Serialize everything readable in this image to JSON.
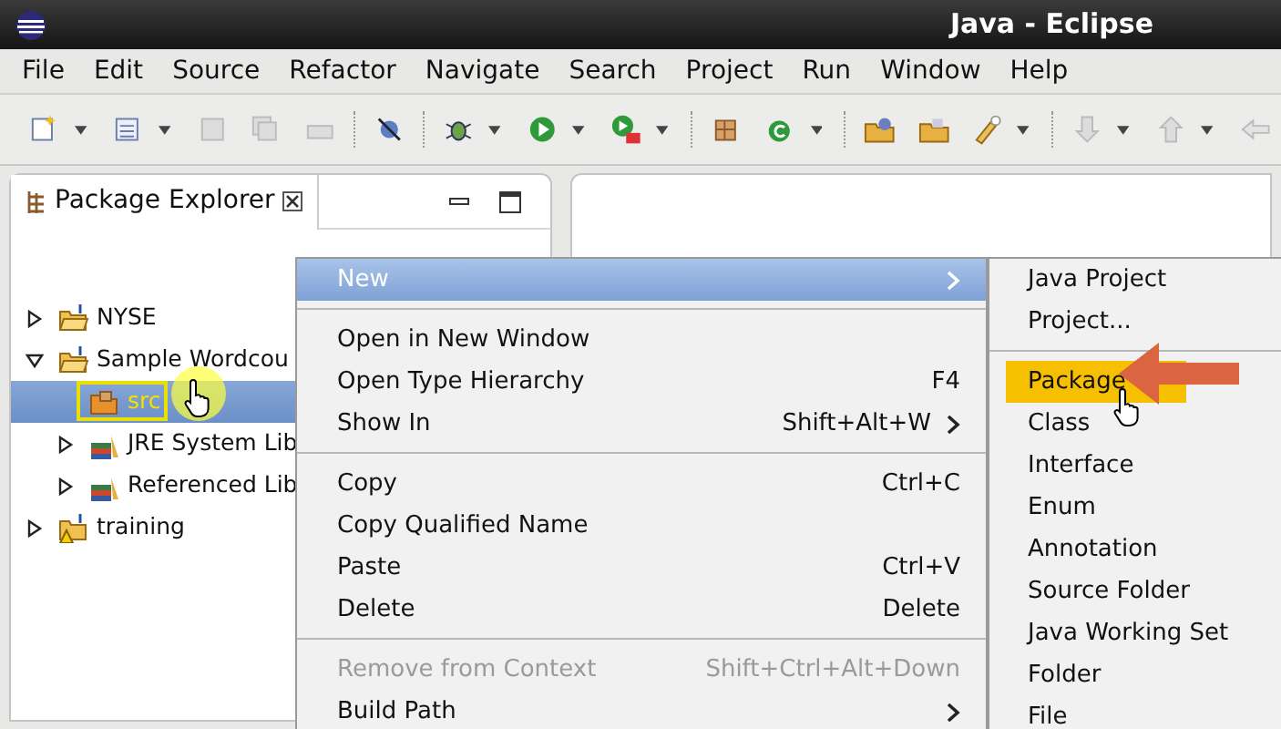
{
  "window": {
    "title": "Java - Eclipse"
  },
  "menu_bar": [
    "File",
    "Edit",
    "Source",
    "Refactor",
    "Navigate",
    "Search",
    "Project",
    "Run",
    "Window",
    "Help"
  ],
  "package_explorer": {
    "tab_title": "Package Explorer",
    "tree": [
      {
        "label": "NYSE",
        "kind": "project",
        "expanded": false,
        "selected": false
      },
      {
        "label": "Sample Wordcou",
        "kind": "project",
        "expanded": true,
        "selected": false,
        "children": [
          {
            "label": "src",
            "kind": "source",
            "selected": true
          },
          {
            "label": "JRE System Lib",
            "kind": "library",
            "expanded": false,
            "selected": false
          },
          {
            "label": "Referenced Lib",
            "kind": "library",
            "expanded": false,
            "selected": false
          }
        ]
      },
      {
        "label": "training",
        "kind": "warning-project",
        "expanded": false,
        "selected": false
      }
    ]
  },
  "context_menu": [
    {
      "kind": "item",
      "label": "New",
      "submenu": true,
      "selected": true,
      "disabled": false
    },
    {
      "kind": "separator"
    },
    {
      "kind": "item",
      "label": "Open in New Window",
      "submenu": false,
      "selected": false,
      "disabled": false
    },
    {
      "kind": "item",
      "label": "Open Type Hierarchy",
      "shortcut": "F4",
      "submenu": false,
      "selected": false,
      "disabled": false
    },
    {
      "kind": "item",
      "label": "Show In",
      "shortcut": "Shift+Alt+W",
      "submenu": true,
      "selected": false,
      "disabled": false
    },
    {
      "kind": "separator"
    },
    {
      "kind": "item",
      "label": "Copy",
      "shortcut": "Ctrl+C",
      "submenu": false,
      "selected": false,
      "disabled": false
    },
    {
      "kind": "item",
      "label": "Copy Qualified Name",
      "submenu": false,
      "selected": false,
      "disabled": false
    },
    {
      "kind": "item",
      "label": "Paste",
      "shortcut": "Ctrl+V",
      "submenu": false,
      "selected": false,
      "disabled": false
    },
    {
      "kind": "item",
      "label": "Delete",
      "shortcut": "Delete",
      "submenu": false,
      "selected": false,
      "disabled": false
    },
    {
      "kind": "separator"
    },
    {
      "kind": "item",
      "label": "Remove from Context",
      "shortcut": "Shift+Ctrl+Alt+Down",
      "submenu": false,
      "selected": false,
      "disabled": true
    },
    {
      "kind": "item",
      "label": "Build Path",
      "submenu": true,
      "selected": false,
      "disabled": false
    }
  ],
  "new_submenu": [
    {
      "kind": "item",
      "label": "Java Project",
      "selected": false
    },
    {
      "kind": "item",
      "label": "Project...",
      "selected": false
    },
    {
      "kind": "separator"
    },
    {
      "kind": "item",
      "label": "Package",
      "selected": true
    },
    {
      "kind": "item",
      "label": "Class",
      "selected": false
    },
    {
      "kind": "item",
      "label": "Interface",
      "selected": false
    },
    {
      "kind": "item",
      "label": "Enum",
      "selected": false
    },
    {
      "kind": "item",
      "label": "Annotation",
      "selected": false
    },
    {
      "kind": "item",
      "label": "Source Folder",
      "selected": false
    },
    {
      "kind": "item",
      "label": "Java Working Set",
      "selected": false
    },
    {
      "kind": "item",
      "label": "Folder",
      "selected": false
    },
    {
      "kind": "item",
      "label": "File",
      "selected": false
    }
  ]
}
